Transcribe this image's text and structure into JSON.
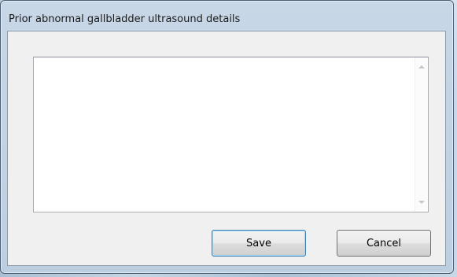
{
  "window": {
    "title": "Prior abnormal gallbladder ultrasound details"
  },
  "details_field": {
    "value": ""
  },
  "buttons": {
    "save_label": "Save",
    "cancel_label": "Cancel"
  }
}
